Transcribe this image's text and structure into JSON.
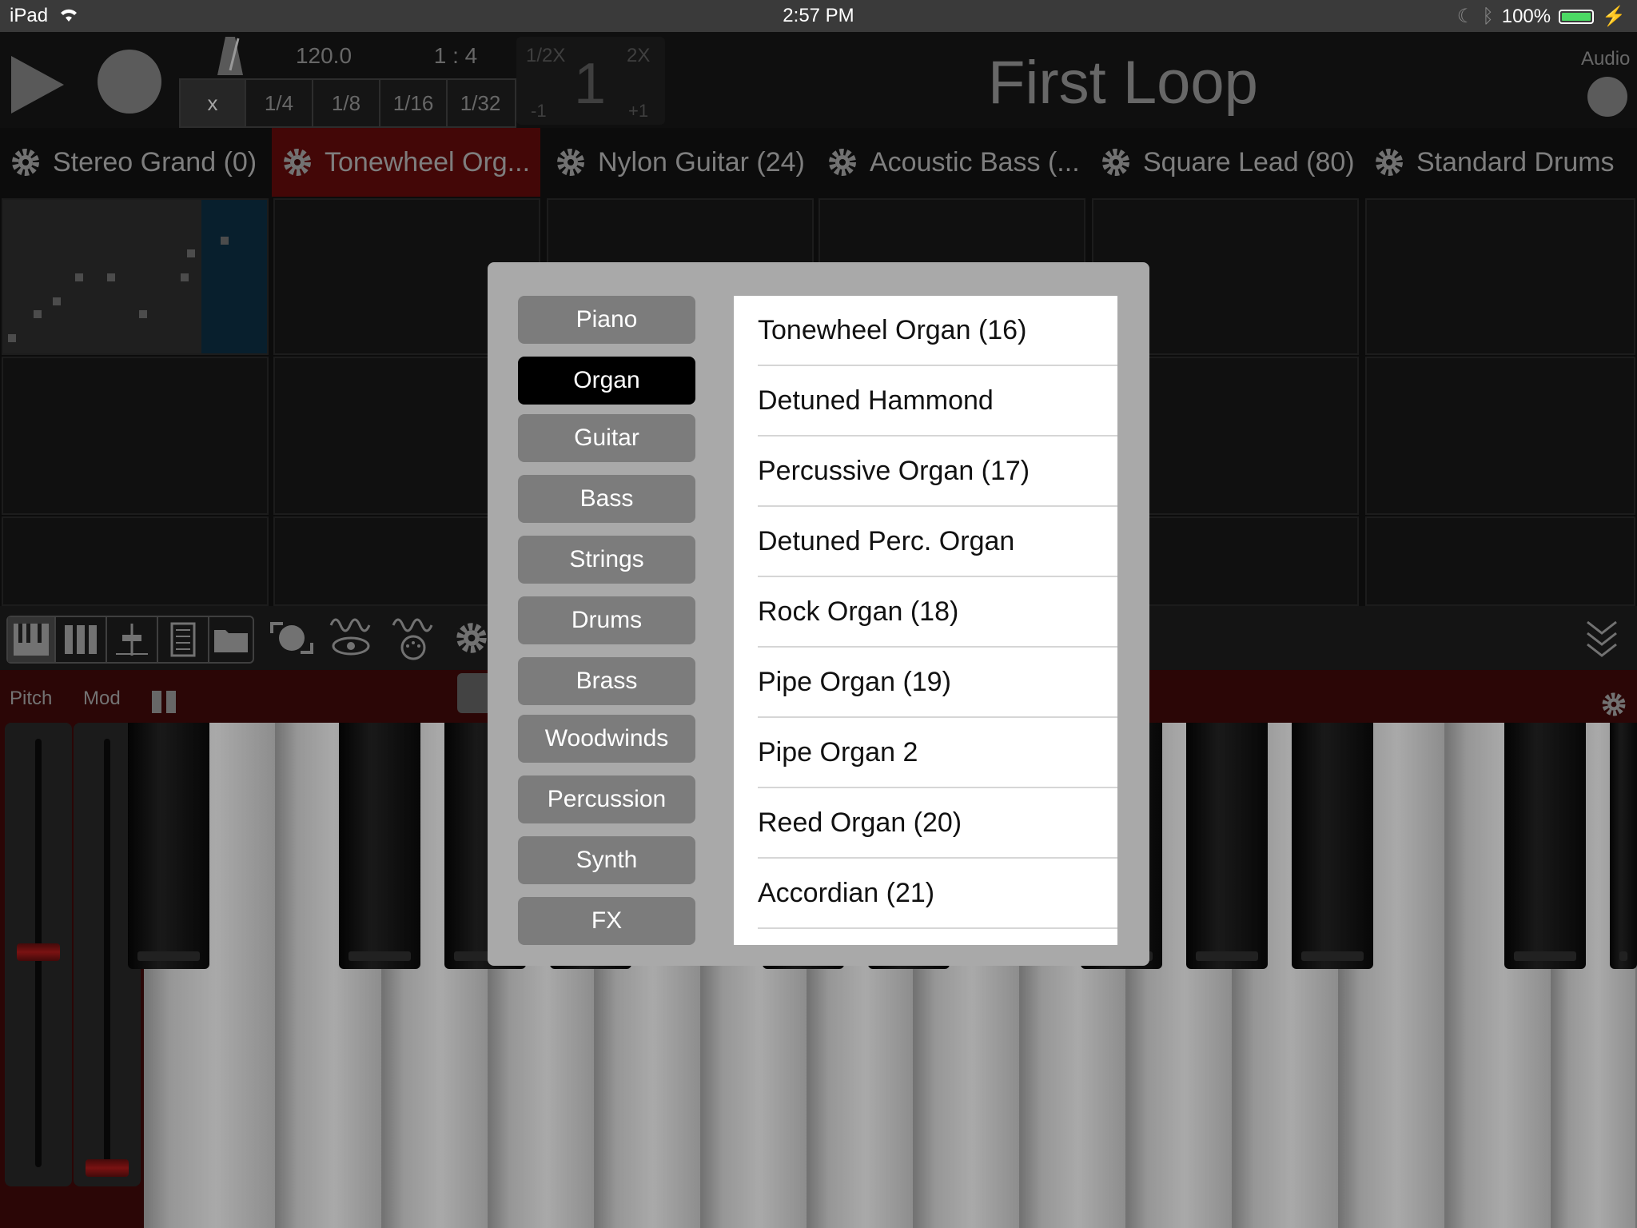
{
  "status_bar": {
    "device": "iPad",
    "time": "2:57 PM",
    "battery": "100%",
    "battery_level": 1.0
  },
  "transport": {
    "tempo": "120.0",
    "time_signature": "1 : 4",
    "half_speed": "1/2X",
    "double_speed": "2X",
    "speed_value": "1",
    "minus": "-1",
    "plus": "+1"
  },
  "quantize": [
    "x",
    "1/4",
    "1/8",
    "1/16",
    "1/32"
  ],
  "loop_title": "First Loop",
  "audio_label": "Audio",
  "tracks": [
    "Stereo Grand (0)",
    "Tonewheel Org...",
    "Nylon Guitar (24)",
    "Acoustic Bass (...",
    "Square Lead (80)",
    "Standard Drums"
  ],
  "keyboard": {
    "pitch_label": "Pitch",
    "mod_label": "Mod"
  },
  "instrument_picker": {
    "categories": [
      "Piano",
      "Organ",
      "Guitar",
      "Bass",
      "Strings",
      "Drums",
      "Brass",
      "Woodwinds",
      "Percussion",
      "Synth",
      "FX"
    ],
    "selected_category": "Organ",
    "instruments": [
      "Tonewheel Organ (16)",
      "Detuned Hammond",
      "Percussive Organ (17)",
      "Detuned Perc. Organ",
      "Rock Organ (18)",
      "Pipe Organ (19)",
      "Pipe Organ 2",
      "Reed Organ (20)",
      "Accordian (21)"
    ]
  },
  "colors": {
    "accent_red": "#5a0a0a",
    "clip_blue": "#0b2a3d",
    "selected_black": "#000000"
  }
}
